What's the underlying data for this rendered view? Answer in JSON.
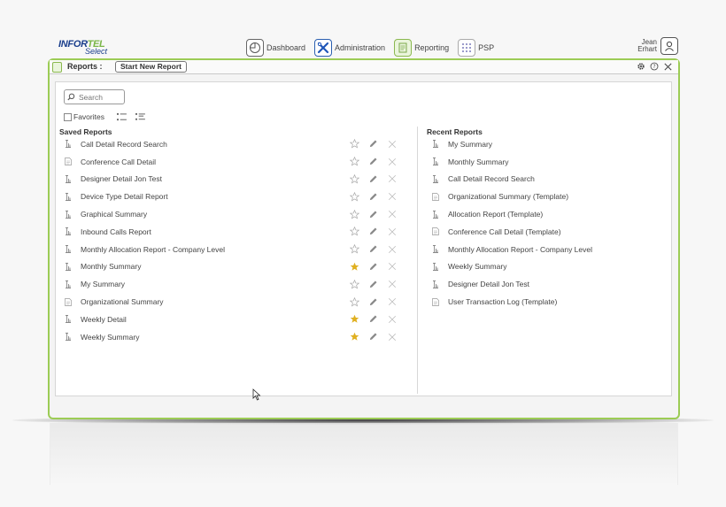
{
  "logo": {
    "line1a": "INFOR",
    "line1b": "TEL",
    "line2": "Select"
  },
  "nav": [
    {
      "label": "Dashboard",
      "icon": "pie-chart-icon"
    },
    {
      "label": "Administration",
      "icon": "tools-icon"
    },
    {
      "label": "Reporting",
      "icon": "report-icon"
    },
    {
      "label": "PSP",
      "icon": "grid-icon"
    }
  ],
  "user": {
    "first": "Jean",
    "last": "Erhart"
  },
  "tab": {
    "title": "Reports :",
    "new_report_label": "Start New Report"
  },
  "search": {
    "placeholder": "Search"
  },
  "favorites": {
    "label": "Favorites"
  },
  "saved": {
    "title": "Saved Reports",
    "items": [
      {
        "label": "Call Detail Record Search",
        "type": "designer",
        "favorite": false
      },
      {
        "label": "Conference Call Detail",
        "type": "template",
        "favorite": false
      },
      {
        "label": "Designer Detail Jon Test",
        "type": "designer",
        "favorite": false
      },
      {
        "label": "Device Type Detail Report",
        "type": "designer",
        "favorite": false
      },
      {
        "label": "Graphical Summary",
        "type": "designer",
        "favorite": false
      },
      {
        "label": "Inbound Calls Report",
        "type": "designer",
        "favorite": false
      },
      {
        "label": "Monthly Allocation Report - Company Level",
        "type": "designer",
        "favorite": false
      },
      {
        "label": "Monthly Summary",
        "type": "designer",
        "favorite": true
      },
      {
        "label": "My Summary",
        "type": "designer",
        "favorite": false
      },
      {
        "label": "Organizational Summary",
        "type": "template",
        "favorite": false
      },
      {
        "label": "Weekly Detail",
        "type": "designer",
        "favorite": true
      },
      {
        "label": "Weekly Summary",
        "type": "designer",
        "favorite": true
      }
    ]
  },
  "recent": {
    "title": "Recent Reports",
    "items": [
      {
        "label": "My Summary",
        "type": "designer"
      },
      {
        "label": "Monthly Summary",
        "type": "designer"
      },
      {
        "label": "Call Detail Record Search",
        "type": "designer"
      },
      {
        "label": "Organizational Summary (Template)",
        "type": "template"
      },
      {
        "label": "Allocation Report (Template)",
        "type": "designer"
      },
      {
        "label": "Conference Call Detail (Template)",
        "type": "template"
      },
      {
        "label": "Monthly Allocation Report - Company Level",
        "type": "designer"
      },
      {
        "label": "Weekly Summary",
        "type": "designer"
      },
      {
        "label": "Designer Detail Jon Test",
        "type": "designer"
      },
      {
        "label": "User Transaction Log (Template)",
        "type": "template"
      }
    ]
  },
  "colors": {
    "accent": "#9ccc55",
    "star": "#e0b020",
    "muted": "#aaaaaa"
  }
}
